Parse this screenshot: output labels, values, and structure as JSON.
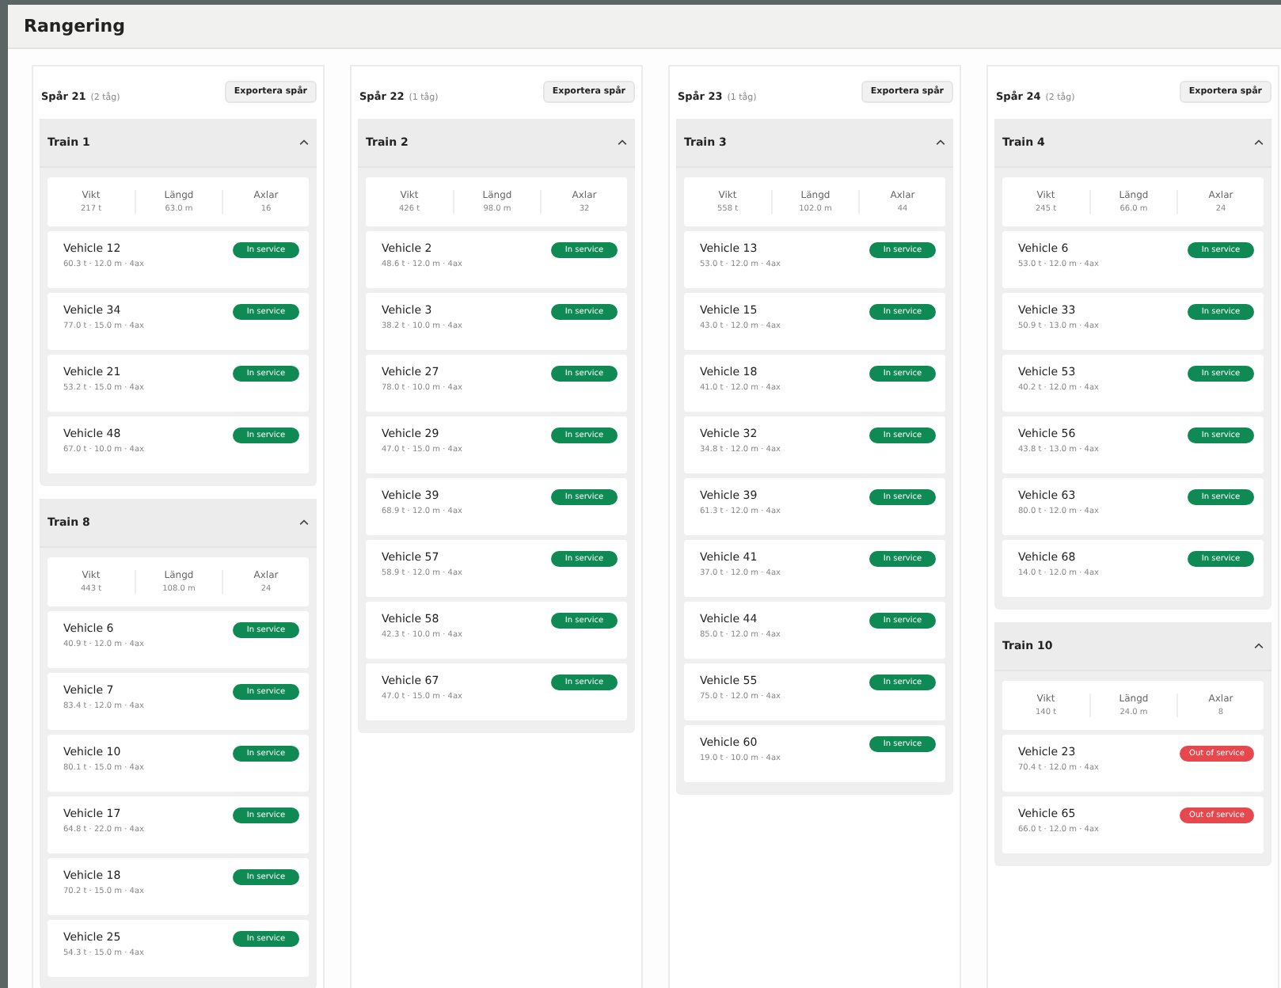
{
  "page_title": "Rangering",
  "tracks": [
    {
      "name": "Spår 21",
      "note": "(2 tåg)",
      "export_label": "Exportera spår",
      "trains": [
        {
          "name": "Train 1",
          "expanded": true,
          "stats": [
            {
              "label": "Vikt",
              "value": "217 t"
            },
            {
              "label": "Längd",
              "value": "63.0 m"
            },
            {
              "label": "Axlar",
              "value": "16"
            }
          ],
          "vehicles": [
            {
              "name": "Vehicle 12",
              "details": "60.3 t · 12.0 m · 4ax",
              "status": "In service",
              "kind": "ok"
            },
            {
              "name": "Vehicle 34",
              "details": "77.0 t · 15.0 m · 4ax",
              "status": "In service",
              "kind": "ok"
            },
            {
              "name": "Vehicle 21",
              "details": "53.2 t · 15.0 m · 4ax",
              "status": "In service",
              "kind": "ok"
            },
            {
              "name": "Vehicle 48",
              "details": "67.0 t · 10.0 m · 4ax",
              "status": "In service",
              "kind": "ok"
            }
          ]
        },
        {
          "name": "Train 8",
          "expanded": true,
          "stats": [
            {
              "label": "Vikt",
              "value": "443 t"
            },
            {
              "label": "Längd",
              "value": "108.0 m"
            },
            {
              "label": "Axlar",
              "value": "24"
            }
          ],
          "vehicles": [
            {
              "name": "Vehicle 6",
              "details": "40.9 t · 12.0 m · 4ax",
              "status": "In service",
              "kind": "ok"
            },
            {
              "name": "Vehicle 7",
              "details": "83.4 t · 12.0 m · 4ax",
              "status": "In service",
              "kind": "ok"
            },
            {
              "name": "Vehicle 10",
              "details": "80.1 t · 15.0 m · 4ax",
              "status": "In service",
              "kind": "ok"
            },
            {
              "name": "Vehicle 17",
              "details": "64.8 t · 22.0 m · 4ax",
              "status": "In service",
              "kind": "ok"
            },
            {
              "name": "Vehicle 18",
              "details": "70.2 t · 15.0 m · 4ax",
              "status": "In service",
              "kind": "ok"
            },
            {
              "name": "Vehicle 25",
              "details": "54.3 t · 15.0 m · 4ax",
              "status": "In service",
              "kind": "ok"
            }
          ]
        }
      ]
    },
    {
      "name": "Spår 22",
      "note": "(1 tåg)",
      "export_label": "Exportera spår",
      "trains": [
        {
          "name": "Train 2",
          "expanded": true,
          "stats": [
            {
              "label": "Vikt",
              "value": "426 t"
            },
            {
              "label": "Längd",
              "value": "98.0 m"
            },
            {
              "label": "Axlar",
              "value": "32"
            }
          ],
          "vehicles": [
            {
              "name": "Vehicle 2",
              "details": "48.6 t · 12.0 m · 4ax",
              "status": "In service",
              "kind": "ok"
            },
            {
              "name": "Vehicle 3",
              "details": "38.2 t · 10.0 m · 4ax",
              "status": "In service",
              "kind": "ok"
            },
            {
              "name": "Vehicle 27",
              "details": "78.0 t · 10.0 m · 4ax",
              "status": "In service",
              "kind": "ok"
            },
            {
              "name": "Vehicle 29",
              "details": "47.0 t · 15.0 m · 4ax",
              "status": "In service",
              "kind": "ok"
            },
            {
              "name": "Vehicle 39",
              "details": "68.9 t · 12.0 m · 4ax",
              "status": "In service",
              "kind": "ok"
            },
            {
              "name": "Vehicle 57",
              "details": "58.9 t · 12.0 m · 4ax",
              "status": "In service",
              "kind": "ok"
            },
            {
              "name": "Vehicle 58",
              "details": "42.3 t · 10.0 m · 4ax",
              "status": "In service",
              "kind": "ok"
            },
            {
              "name": "Vehicle 67",
              "details": "47.0 t · 15.0 m · 4ax",
              "status": "In service",
              "kind": "ok"
            }
          ]
        }
      ]
    },
    {
      "name": "Spår 23",
      "note": "(1 tåg)",
      "export_label": "Exportera spår",
      "trains": [
        {
          "name": "Train 3",
          "expanded": true,
          "stats": [
            {
              "label": "Vikt",
              "value": "558 t"
            },
            {
              "label": "Längd",
              "value": "102.0 m"
            },
            {
              "label": "Axlar",
              "value": "44"
            }
          ],
          "vehicles": [
            {
              "name": "Vehicle 13",
              "details": "53.0 t · 12.0 m · 4ax",
              "status": "In service",
              "kind": "ok"
            },
            {
              "name": "Vehicle 15",
              "details": "43.0 t · 12.0 m · 4ax",
              "status": "In service",
              "kind": "ok"
            },
            {
              "name": "Vehicle 18",
              "details": "41.0 t · 12.0 m · 4ax",
              "status": "In service",
              "kind": "ok"
            },
            {
              "name": "Vehicle 32",
              "details": "34.8 t · 12.0 m · 4ax",
              "status": "In service",
              "kind": "ok"
            },
            {
              "name": "Vehicle 39",
              "details": "61.3 t · 12.0 m · 4ax",
              "status": "In service",
              "kind": "ok"
            },
            {
              "name": "Vehicle 41",
              "details": "37.0 t · 12.0 m · 4ax",
              "status": "In service",
              "kind": "ok"
            },
            {
              "name": "Vehicle 44",
              "details": "85.0 t · 12.0 m · 4ax",
              "status": "In service",
              "kind": "ok"
            },
            {
              "name": "Vehicle 55",
              "details": "75.0 t · 12.0 m · 4ax",
              "status": "In service",
              "kind": "ok"
            },
            {
              "name": "Vehicle 60",
              "details": "19.0 t · 10.0 m · 4ax",
              "status": "In service",
              "kind": "ok"
            }
          ]
        }
      ]
    },
    {
      "name": "Spår 24",
      "note": "(2 tåg)",
      "export_label": "Exportera spår",
      "trains": [
        {
          "name": "Train 4",
          "expanded": true,
          "stats": [
            {
              "label": "Vikt",
              "value": "245 t"
            },
            {
              "label": "Längd",
              "value": "66.0 m"
            },
            {
              "label": "Axlar",
              "value": "24"
            }
          ],
          "vehicles": [
            {
              "name": "Vehicle 6",
              "details": "53.0 t · 12.0 m · 4ax",
              "status": "In service",
              "kind": "ok"
            },
            {
              "name": "Vehicle 33",
              "details": "50.9 t · 13.0 m · 4ax",
              "status": "In service",
              "kind": "ok"
            },
            {
              "name": "Vehicle 53",
              "details": "40.2 t · 12.0 m · 4ax",
              "status": "In service",
              "kind": "ok"
            },
            {
              "name": "Vehicle 56",
              "details": "43.8 t · 13.0 m · 4ax",
              "status": "In service",
              "kind": "ok"
            },
            {
              "name": "Vehicle 63",
              "details": "80.0 t · 12.0 m · 4ax",
              "status": "In service",
              "kind": "ok"
            },
            {
              "name": "Vehicle 68",
              "details": "14.0 t · 12.0 m · 4ax",
              "status": "In service",
              "kind": "ok"
            }
          ]
        },
        {
          "name": "Train 10",
          "expanded": true,
          "stats": [
            {
              "label": "Vikt",
              "value": "140 t"
            },
            {
              "label": "Längd",
              "value": "24.0 m"
            },
            {
              "label": "Axlar",
              "value": "8"
            }
          ],
          "vehicles": [
            {
              "name": "Vehicle 23",
              "details": "70.4 t · 12.0 m · 4ax",
              "status": "Out of service",
              "kind": "bad"
            },
            {
              "name": "Vehicle 65",
              "details": "66.0 t · 12.0 m · 4ax",
              "status": "Out of service",
              "kind": "bad"
            }
          ]
        }
      ]
    }
  ]
}
